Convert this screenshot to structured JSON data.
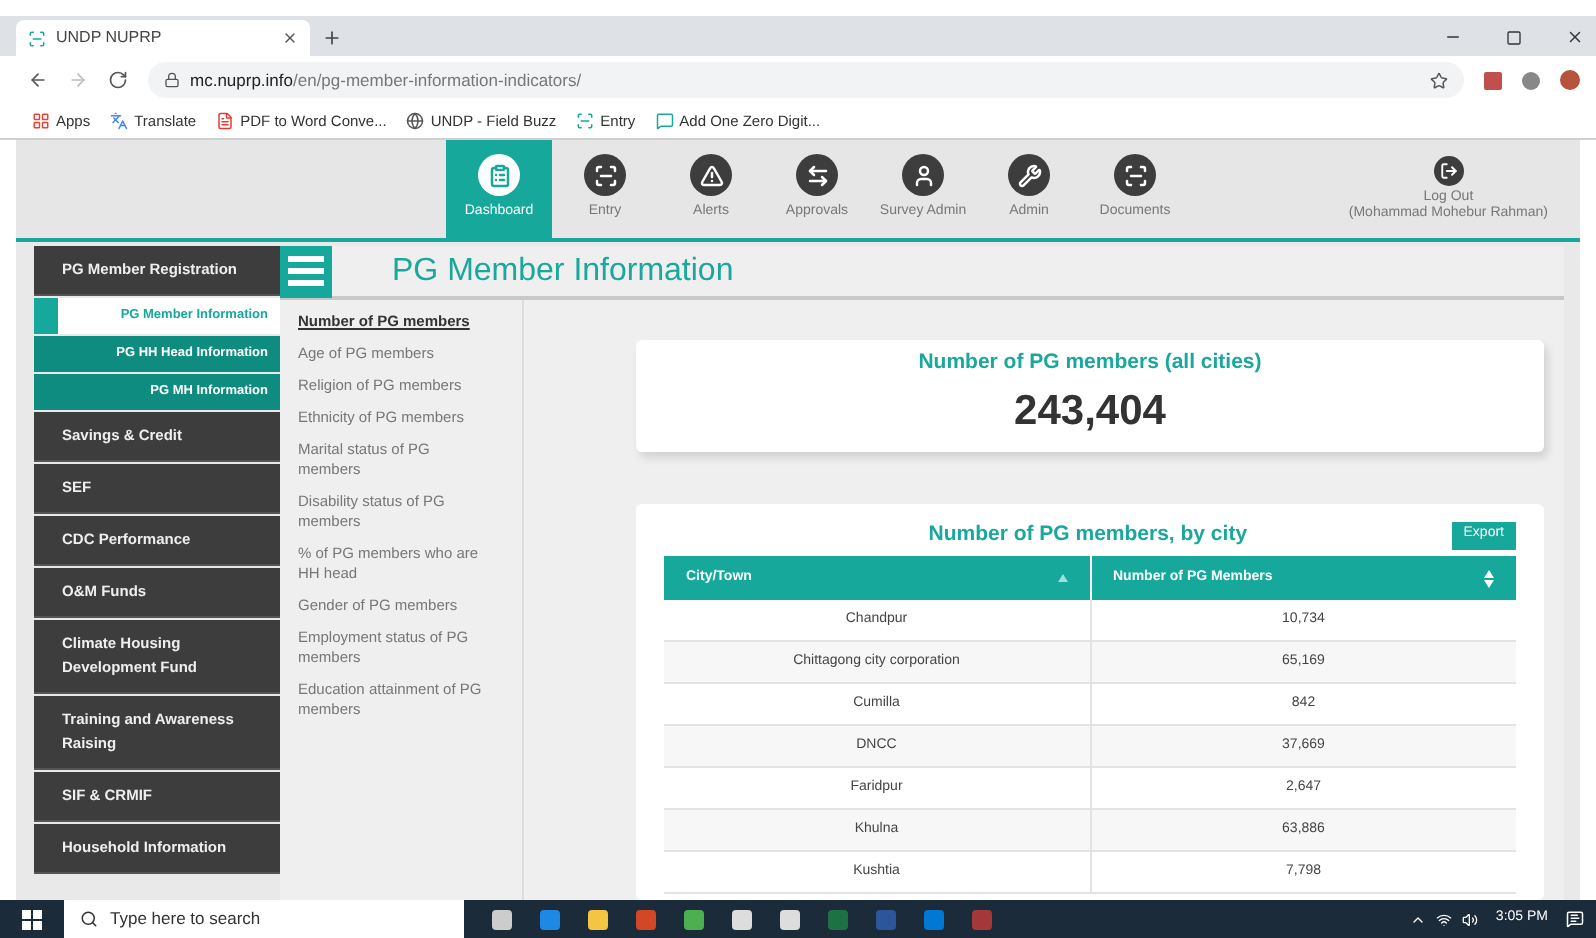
{
  "browser": {
    "tab_title": "UNDP NUPRP",
    "url": "**mc.nuprp.info**/en/pg-member-information-indicators/",
    "bookmarks": [
      {
        "label": "Apps",
        "kind": "apps"
      },
      {
        "label": "Translate",
        "kind": "translate"
      },
      {
        "label": "PDF to Word Conve...",
        "kind": "pdf"
      },
      {
        "label": "UNDP - Field Buzz",
        "kind": "globe"
      },
      {
        "label": "Entry",
        "kind": "site"
      },
      {
        "label": "Add One Zero Digit...",
        "kind": "chat"
      }
    ]
  },
  "nav": [
    {
      "label": "Dashboard",
      "kind": "dashboard",
      "selected": true
    },
    {
      "label": "Entry",
      "kind": "scan",
      "selected": false
    },
    {
      "label": "Alerts",
      "kind": "alert",
      "selected": false
    },
    {
      "label": "Approvals",
      "kind": "arrows",
      "selected": false
    },
    {
      "label": "Survey Admin",
      "kind": "user",
      "selected": false
    },
    {
      "label": "Admin",
      "kind": "tools",
      "selected": false
    },
    {
      "label": "Documents",
      "kind": "scan",
      "selected": false
    }
  ],
  "logout": {
    "label": "Log Out",
    "user": "(Mohammad Mohebur Rahman)"
  },
  "sidebar": [
    {
      "label": "PG Member Registration",
      "children": [
        {
          "label": "PG Member Information",
          "selected": true
        },
        {
          "label": "PG HH Head Information",
          "selected": false
        },
        {
          "label": "PG MH Information",
          "selected": false
        }
      ]
    },
    {
      "label": "Savings & Credit"
    },
    {
      "label": "SEF"
    },
    {
      "label": "CDC Performance"
    },
    {
      "label": "O&M Funds"
    },
    {
      "label": "Climate Housing Development Fund"
    },
    {
      "label": "Training and Awareness Raising"
    },
    {
      "label": "SIF & CRMIF"
    },
    {
      "label": "Household Information"
    }
  ],
  "page_title": "PG Member Information",
  "indicators": [
    {
      "label": "Number of PG members",
      "selected": true
    },
    {
      "label": "Age of PG members",
      "selected": false
    },
    {
      "label": "Religion of PG members",
      "selected": false
    },
    {
      "label": "Ethnicity of PG members",
      "selected": false
    },
    {
      "label": "Marital status of PG members",
      "selected": false
    },
    {
      "label": "Disability status of PG members",
      "selected": false
    },
    {
      "label": "% of PG members who are HH head",
      "selected": false
    },
    {
      "label": "Gender of PG members",
      "selected": false
    },
    {
      "label": "Employment status of PG members",
      "selected": false
    },
    {
      "label": "Education attainment of PG members",
      "selected": false
    }
  ],
  "total_card": {
    "title": "Number of PG members (all cities)",
    "value": "243,404"
  },
  "city_table": {
    "title": "Number of PG members, by city",
    "export": "Export",
    "columns": [
      {
        "label": "City/Town",
        "sorted": true
      },
      {
        "label": "Number of PG Members",
        "sorted": false
      }
    ],
    "rows": [
      [
        "Chandpur",
        "10,734"
      ],
      [
        "Chittagong city corporation",
        "65,169"
      ],
      [
        "Cumilla",
        "842"
      ],
      [
        "DNCC",
        "37,669"
      ],
      [
        "Faridpur",
        "2,647"
      ],
      [
        "Khulna",
        "63,886"
      ],
      [
        "Kushtia",
        "7,798"
      ]
    ]
  },
  "taskbar": {
    "search_placeholder": "Type here to search",
    "time": "3:05 PM"
  }
}
